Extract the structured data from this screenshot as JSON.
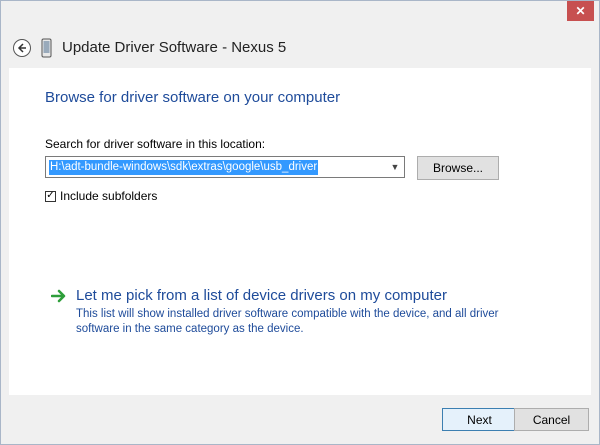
{
  "window": {
    "close_glyph": "✕"
  },
  "header": {
    "title": "Update Driver Software - Nexus 5",
    "back_icon": "back-arrow-icon",
    "device_icon": "phone-icon"
  },
  "main": {
    "heading": "Browse for driver software on your computer",
    "search_label": "Search for driver software in this location:",
    "path_value": "H:\\adt-bundle-windows\\sdk\\extras\\google\\usb_driver",
    "browse_label": "Browse...",
    "include_subfolders_label": "Include subfolders",
    "include_subfolders_checked": true,
    "pick_title": "Let me pick from a list of device drivers on my computer",
    "pick_description": "This list will show installed driver software compatible with the device, and all driver software in the same category as the device."
  },
  "footer": {
    "next_label": "Next",
    "cancel_label": "Cancel"
  },
  "colors": {
    "link_blue": "#1e4b9a",
    "close_red": "#c75050",
    "selection_blue": "#3399ff",
    "arrow_green": "#2e9e3a"
  }
}
